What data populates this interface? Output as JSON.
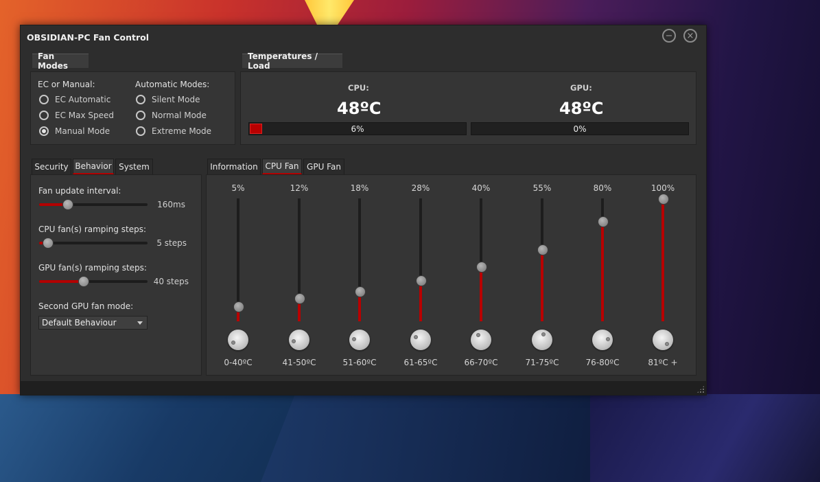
{
  "window": {
    "title": "OBSIDIAN-PC Fan Control",
    "minimize_glyph": "−",
    "close_glyph": "×"
  },
  "fan_modes": {
    "header": "Fan Modes",
    "ec_manual_label": "EC or Manual:",
    "automatic_label": "Automatic Modes:",
    "ec_options": [
      {
        "label": "EC Automatic",
        "selected": false
      },
      {
        "label": "EC Max Speed",
        "selected": false
      },
      {
        "label": "Manual Mode",
        "selected": true
      }
    ],
    "auto_options": [
      {
        "label": "Silent Mode",
        "selected": false
      },
      {
        "label": "Normal Mode",
        "selected": false
      },
      {
        "label": "Extreme Mode",
        "selected": false
      }
    ]
  },
  "temps": {
    "header": "Temperatures / Load",
    "cpu": {
      "label": "CPU:",
      "temp": "48ºC",
      "load": "6%",
      "load_value": 0.06
    },
    "gpu": {
      "label": "GPU:",
      "temp": "48ºC",
      "load": "0%",
      "load_value": 0.0
    }
  },
  "left_tabs": [
    {
      "label": "Security",
      "active": false
    },
    {
      "label": "Behavior",
      "active": true
    },
    {
      "label": "System",
      "active": false
    }
  ],
  "behavior": {
    "update_interval": {
      "label": "Fan update interval:",
      "value": "160ms",
      "level": 0.26
    },
    "cpu_steps": {
      "label": "CPU fan(s) ramping steps:",
      "value": "5 steps",
      "level": 0.08
    },
    "gpu_steps": {
      "label": "GPU fan(s) ramping steps:",
      "value": "40 steps",
      "level": 0.41
    },
    "second_gpu": {
      "label": "Second GPU fan mode:",
      "selected": "Default Behaviour"
    }
  },
  "right_tabs": [
    {
      "label": "Information",
      "active": false
    },
    {
      "label": "CPU Fan",
      "active": true
    },
    {
      "label": "GPU Fan",
      "active": false
    }
  ],
  "cpu_fan_curve": [
    {
      "percent": "5%",
      "level": 0.05,
      "range": "0-40ºC"
    },
    {
      "percent": "12%",
      "level": 0.12,
      "range": "41-50ºC"
    },
    {
      "percent": "18%",
      "level": 0.18,
      "range": "51-60ºC"
    },
    {
      "percent": "28%",
      "level": 0.28,
      "range": "61-65ºC"
    },
    {
      "percent": "40%",
      "level": 0.4,
      "range": "66-70ºC"
    },
    {
      "percent": "55%",
      "level": 0.55,
      "range": "71-75ºC"
    },
    {
      "percent": "80%",
      "level": 0.8,
      "range": "76-80ºC"
    },
    {
      "percent": "100%",
      "level": 1.0,
      "range": "81ºC +"
    }
  ],
  "colors": {
    "accent": "#b80000",
    "window_bg": "#2d2d2d",
    "panel_bg": "#353535"
  }
}
